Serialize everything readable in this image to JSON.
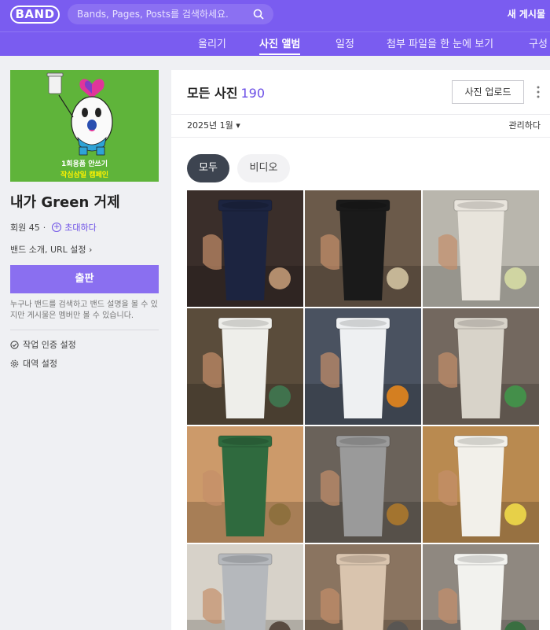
{
  "header": {
    "logo": "BAND",
    "search_placeholder": "Bands, Pages, Posts를 검색하세요.",
    "new_posts": "새 게시물"
  },
  "nav": {
    "items": [
      "올리기",
      "사진 앨범",
      "일정",
      "첨부 파일을 한 눈에 보기",
      "구성"
    ],
    "active": "사진 앨범"
  },
  "sidebar": {
    "cover_line1": "1회용품 안쓰기",
    "cover_line2": "작심삼일 캠페인",
    "band_name": "내가 Green 거제",
    "members_label": "회원 45",
    "separator": "·",
    "invite_label": "초대하다",
    "intro_label": "밴드 소개, URL 설정",
    "intro_chevron": "›",
    "publish_label": "출판",
    "description": "누구나 밴드를 검색하고 밴드 설명을 볼 수 있지만 게시물은 멤버만 볼 수 있습니다.",
    "settings": [
      {
        "label": "작업 인증 설정",
        "icon": "check-circle-icon"
      },
      {
        "label": "대역 설정",
        "icon": "gear-icon"
      }
    ]
  },
  "main": {
    "title": "모든 사진",
    "count": "190",
    "upload_label": "사진 업로드",
    "month": "2025년 1월",
    "month_caret": "▾",
    "manage_label": "관리하다",
    "tabs": [
      "모두",
      "비디오"
    ],
    "active_tab": "모두"
  },
  "photos": [
    {
      "desc": "navy tumbler",
      "bg": "#3a2e2a",
      "cup": "#1c2440",
      "accent": "#c9a07a"
    },
    {
      "desc": "black mug with tea bag",
      "bg": "#6b5a4a",
      "cup": "#1a1a1a",
      "accent": "#d8c9a6"
    },
    {
      "desc": "white cup with straw lid",
      "bg": "#b9b6ad",
      "cup": "#e8e4dc",
      "accent": "#d9e0a6"
    },
    {
      "desc": "white speckled tumbler",
      "bg": "#5a4c3b",
      "cup": "#eeeeea",
      "accent": "#3e7b52"
    },
    {
      "desc": "blue bottle mug with orange",
      "bg": "#4a5260",
      "cup": "#eef0f2",
      "accent": "#ee8a1a"
    },
    {
      "desc": "glass jar and mug",
      "bg": "#73685f",
      "cup": "#d8d3c9",
      "accent": "#3f9a4a"
    },
    {
      "desc": "green tumbler with tea",
      "bg": "#cc9a6a",
      "cup": "#2f6a3e",
      "accent": "#8a6d3a"
    },
    {
      "desc": "stainless cup top view",
      "bg": "#6a625a",
      "cup": "#9a9a9a",
      "accent": "#b07a2a"
    },
    {
      "desc": "white tumbler with sticky note",
      "bg": "#b98a50",
      "cup": "#f2f0ea",
      "accent": "#f4e04a"
    },
    {
      "desc": "silver tumbler in hand",
      "bg": "#d7d2c9",
      "cup": "#b5b8bc",
      "accent": "#4a3a30"
    },
    {
      "desc": "beige mug on desk",
      "bg": "#8a7460",
      "cup": "#d9c4ae",
      "accent": "#555555"
    },
    {
      "desc": "starbucks mug with green lining",
      "bg": "#8f8880",
      "cup": "#f2f2ee",
      "accent": "#2f6f3a"
    }
  ]
}
